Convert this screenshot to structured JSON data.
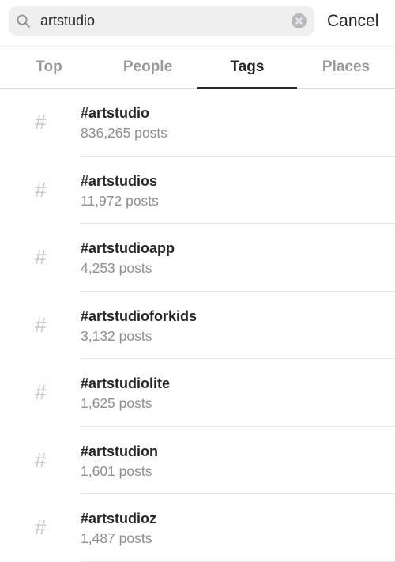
{
  "search": {
    "query": "artstudio",
    "cancel_label": "Cancel",
    "icon": "search-icon",
    "clear_icon": "clear-icon"
  },
  "tabs": [
    {
      "label": "Top",
      "active": false
    },
    {
      "label": "People",
      "active": false
    },
    {
      "label": "Tags",
      "active": true
    },
    {
      "label": "Places",
      "active": false
    }
  ],
  "results": [
    {
      "symbol": "#",
      "name": "#artstudio",
      "count": "836,265 posts"
    },
    {
      "symbol": "#",
      "name": "#artstudios",
      "count": "11,972 posts"
    },
    {
      "symbol": "#",
      "name": "#artstudioapp",
      "count": "4,253 posts"
    },
    {
      "symbol": "#",
      "name": "#artstudioforkids",
      "count": "3,132 posts"
    },
    {
      "symbol": "#",
      "name": "#artstudiolite",
      "count": "1,625 posts"
    },
    {
      "symbol": "#",
      "name": "#artstudion",
      "count": "1,601 posts"
    },
    {
      "symbol": "#",
      "name": "#artstudioz",
      "count": "1,487 posts"
    }
  ],
  "colors": {
    "search_bg": "#efeff0",
    "active_text": "#262626",
    "inactive_text": "#9a9a9a",
    "muted_text": "#8e8e8e"
  }
}
